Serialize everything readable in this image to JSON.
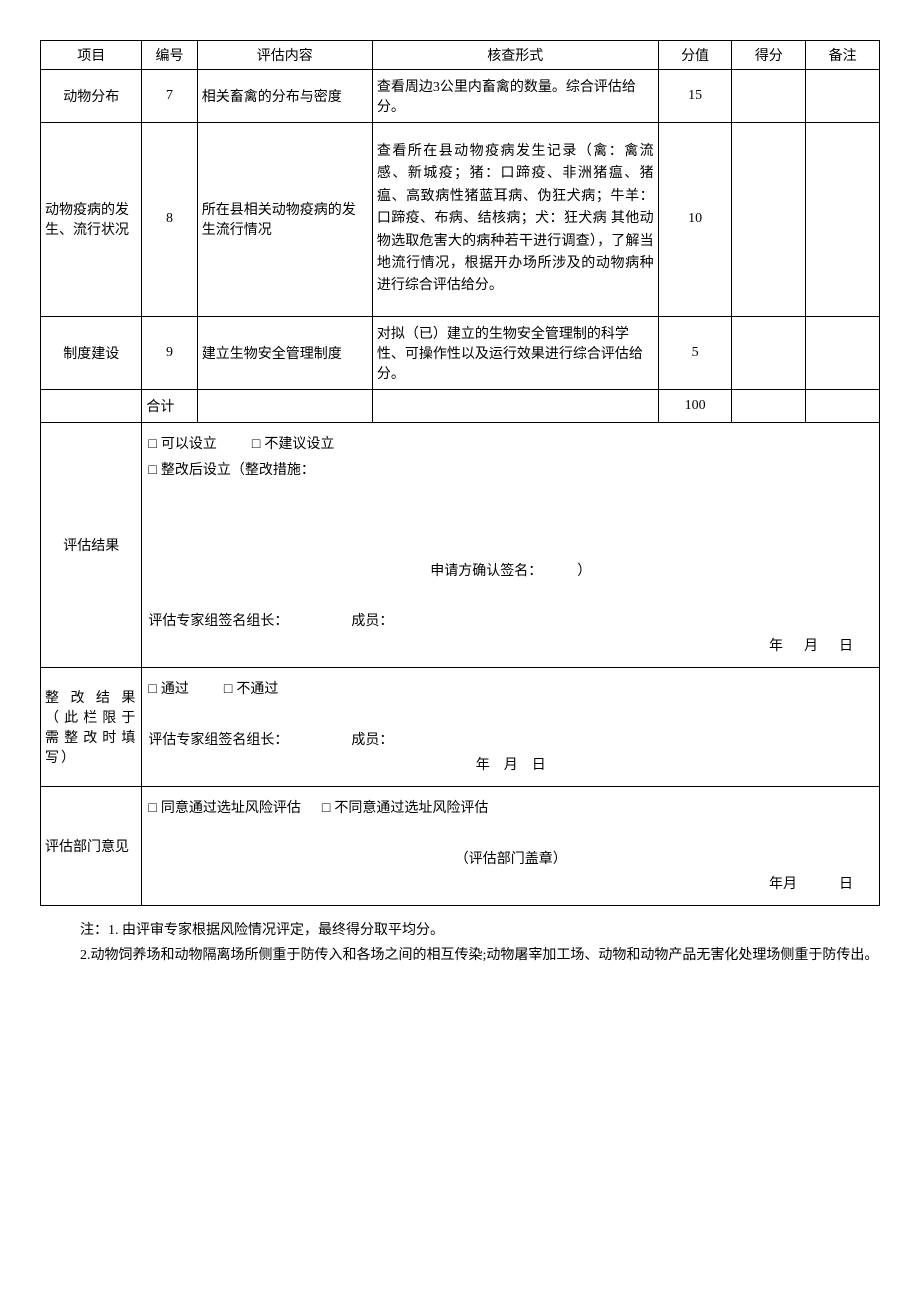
{
  "h": {
    "c1": "项目",
    "c2": "编号",
    "c3": "评估内容",
    "c4": "核查形式",
    "c5": "分值",
    "c6": "得分",
    "c7": "备注"
  },
  "r7": {
    "p": "动物分布",
    "n": "7",
    "c": "相关畜禽的分布与密度",
    "f": "查看周边3公里内畜禽的数量。综合评估给分。",
    "s": "15"
  },
  "r8": {
    "p": "动物疫病的发生、流行状况",
    "n": "8",
    "c": "所在县相关动物疫病的发生流行情况",
    "f": "查看所在县动物疫病发生记录（禽：禽流感、新城疫；猪：口蹄疫、非洲猪瘟、猪瘟、高致病性猪蓝耳病、伪狂犬病；牛羊：口蹄疫、布病、结核病；犬：狂犬病 其他动物选取危害大的病种若干进行调查），了解当地流行情况，根据开办场所涉及的动物病种进行综合评估给分。",
    "s": "10"
  },
  "r9": {
    "p": "制度建设",
    "n": "9",
    "c": "建立生物安全管理制度",
    "f": "对拟（已）建立的生物安全管理制的科学性、可操作性以及运行效果进行综合评估给分。",
    "s": "5"
  },
  "tot": {
    "l": "合计",
    "s": "100"
  },
  "res": {
    "label": "评估结果",
    "o1": "可以设立",
    "o2": "不建议设立",
    "o3": "整改后设立（整改措施：",
    "app": "申请方确认签名：",
    "app2": "）",
    "sig": "评估专家组签名组长：",
    "mem": "成员：",
    "y": "年",
    "m": "月",
    "d": "日"
  },
  "rec": {
    "label": "整改结果（此栏限于需整改时填写）",
    "o1": "通过",
    "o2": "不通过",
    "sig": "评估专家组签名组长：",
    "mem": "成员：",
    "y": "年",
    "m": "月",
    "d": "日"
  },
  "dep": {
    "label": "评估部门意见",
    "o1": "同意通过选址风险评估",
    "o2": "不同意通过选址风险评估",
    "stamp": "（评估部门盖章）",
    "y": "年",
    "m": "月",
    "d": "日"
  },
  "notes": {
    "n1": "注：1. 由评审专家根据风险情况评定，最终得分取平均分。",
    "n2": "2.动物饲养场和动物隔离场所侧重于防传入和各场之间的相互传染;动物屠宰加工场、动物和动物产品无害化处理场侧重于防传出。"
  },
  "cb": "□"
}
